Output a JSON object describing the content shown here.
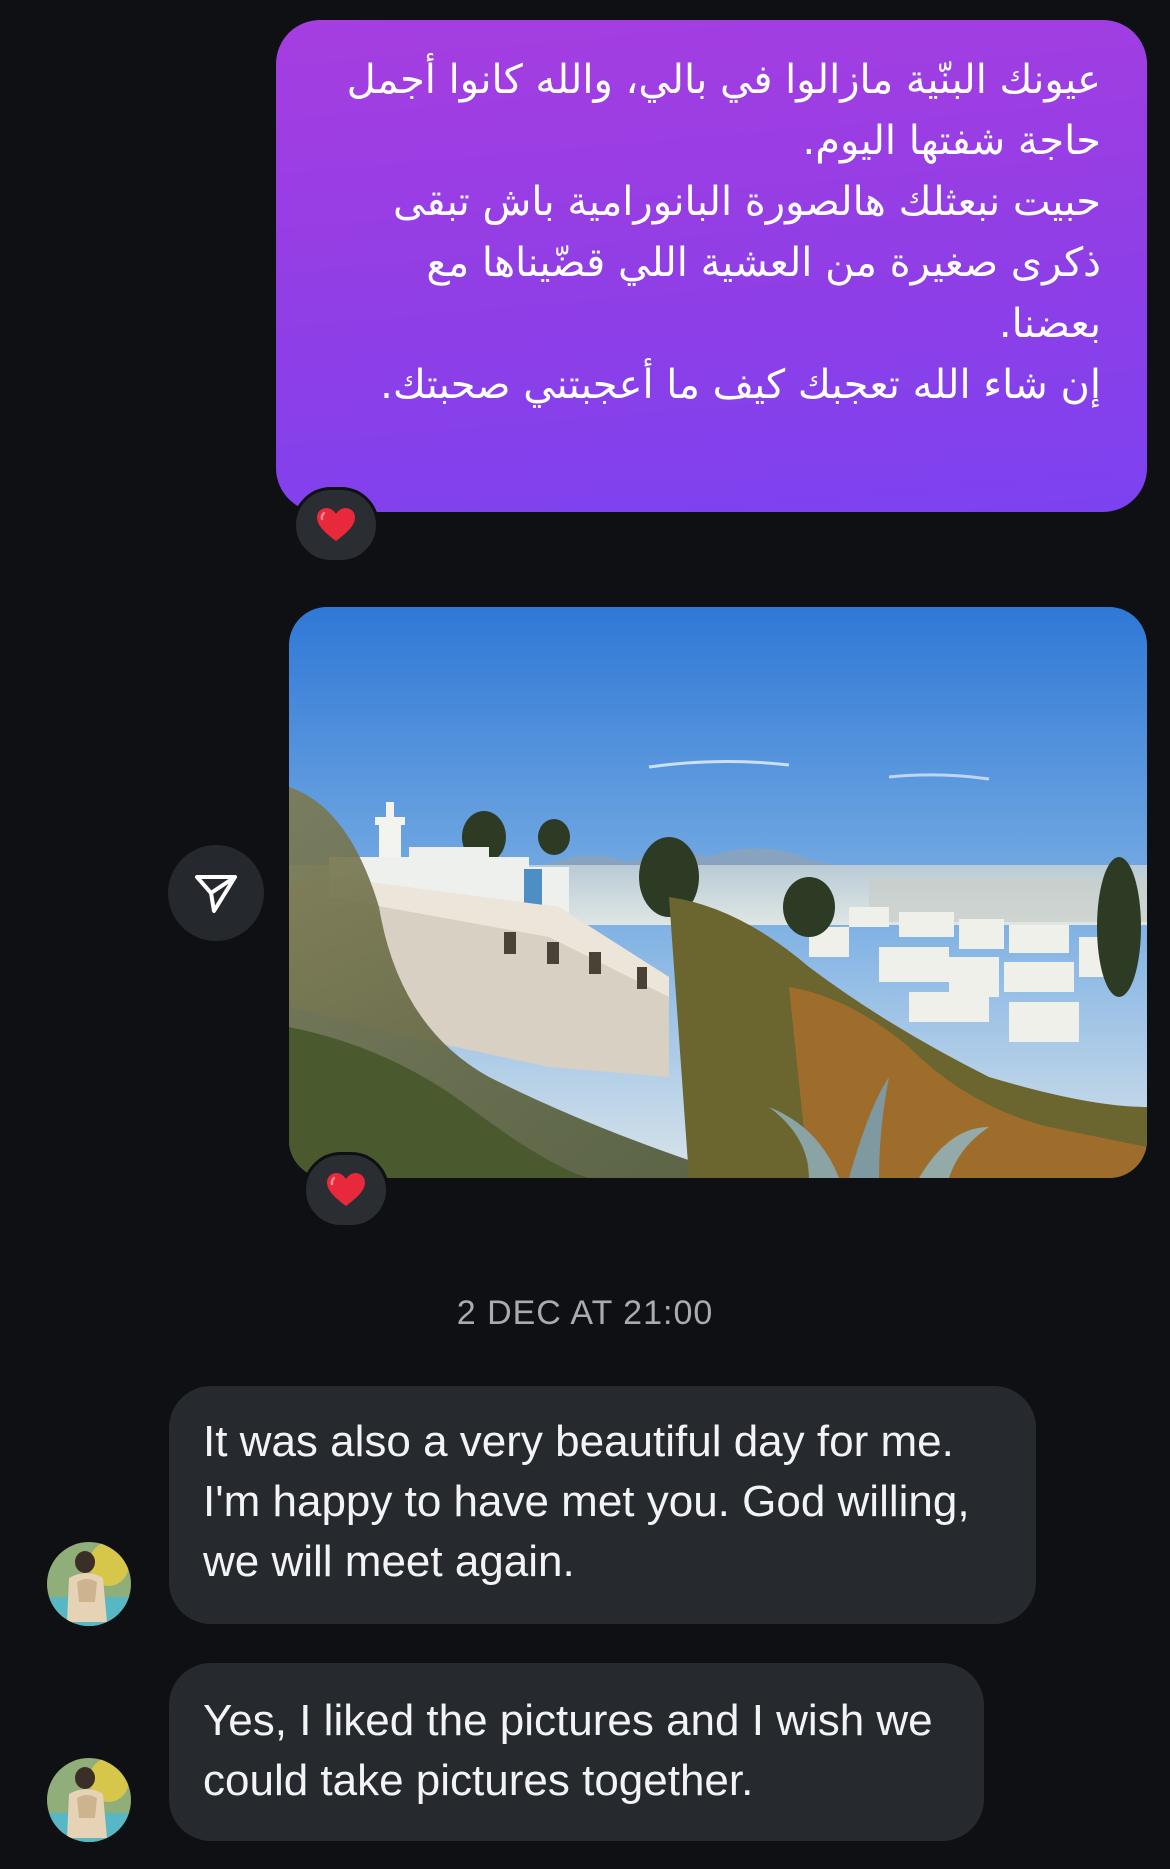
{
  "outgoing_message": {
    "lines": [
      "عيونك البنّية مازالوا في بالي، والله كانوا أجمل حاجة شفتها اليوم.",
      "حبيت نبعثلك هالصورة البانورامية باش تبقى ذكرى صغيرة من العشية اللي قضّيناها مع بعضنا.",
      "إن شاء الله تعجبك كيف ما أعجبتني صحبتك."
    ],
    "reaction": "heart-emoji"
  },
  "photo_message": {
    "reaction": "heart-emoji",
    "share_icon": "send-icon"
  },
  "timestamp": "2 DEC AT 21:00",
  "incoming_messages": [
    {
      "text": "It was also a very beautiful day for me. I'm happy to have met you. God willing, we will meet again."
    },
    {
      "text": "Yes, I liked the pictures and I wish we could take pictures together."
    }
  ],
  "colors": {
    "background": "#0e1013",
    "outgoing_bubble": "#9a3fe4",
    "incoming_bubble": "#26292d",
    "heart": "#e8283b"
  }
}
